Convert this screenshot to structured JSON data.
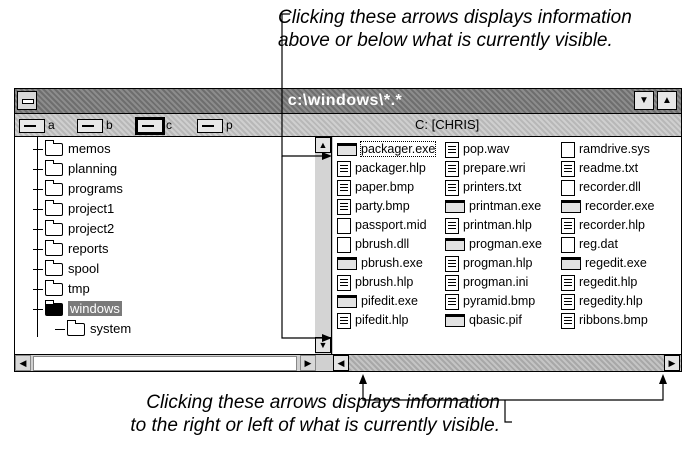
{
  "callouts": {
    "top_line1": "Clicking these arrows displays information",
    "top_line2": "above or below what is currently visible.",
    "bottom_line1": "Clicking these arrows displays information",
    "bottom_line2": "to the right or left of what is currently visible."
  },
  "window": {
    "title": "c:\\windows\\*.*",
    "drive_label": "C: [CHRIS]",
    "drives": [
      {
        "letter": "a",
        "icon": "floppy-drive-icon"
      },
      {
        "letter": "b",
        "icon": "floppy-drive-icon"
      },
      {
        "letter": "c",
        "icon": "hard-drive-icon",
        "selected": true
      },
      {
        "letter": "p",
        "icon": "network-drive-icon"
      }
    ]
  },
  "tree": {
    "items": [
      "memos",
      "planning",
      "programs",
      "project1",
      "project2",
      "reports",
      "spool",
      "tmp",
      "windows",
      "system"
    ],
    "selected": "windows"
  },
  "files": {
    "col1": [
      "packager.exe",
      "packager.hlp",
      "paper.bmp",
      "party.bmp",
      "passport.mid",
      "pbrush.dll",
      "pbrush.exe",
      "pbrush.hlp",
      "pifedit.exe",
      "pifedit.hlp"
    ],
    "col2": [
      "pop.wav",
      "prepare.wri",
      "printers.txt",
      "printman.exe",
      "printman.hlp",
      "progman.exe",
      "progman.hlp",
      "progman.ini",
      "pyramid.bmp",
      "qbasic.pif"
    ],
    "col3": [
      "ramdrive.sys",
      "readme.txt",
      "recorder.dll",
      "recorder.exe",
      "recorder.hlp",
      "reg.dat",
      "regedit.exe",
      "regedit.hlp",
      "regedity.hlp",
      "ribbons.bmp"
    ]
  }
}
